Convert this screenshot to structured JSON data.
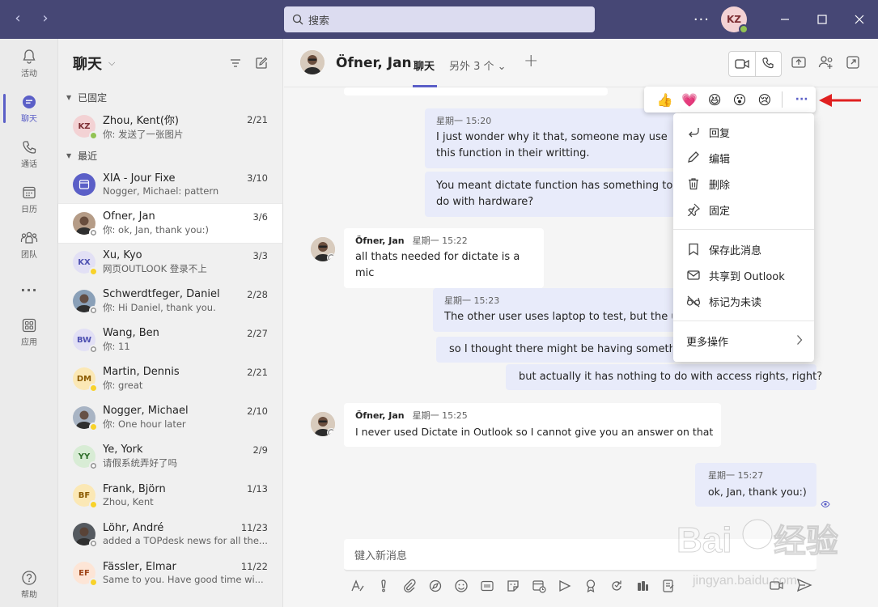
{
  "window": {
    "search_placeholder": "搜索",
    "more": "···",
    "user_initials": "KZ"
  },
  "rail": {
    "items": [
      {
        "label": "活动",
        "icon": "bell-icon"
      },
      {
        "label": "聊天",
        "icon": "chat-icon",
        "active": true
      },
      {
        "label": "通话",
        "icon": "phone-icon"
      },
      {
        "label": "日历",
        "icon": "calendar-icon"
      },
      {
        "label": "团队",
        "icon": "teams-icon"
      },
      {
        "label": "···",
        "icon": "more-icon"
      },
      {
        "label": "应用",
        "icon": "apps-icon"
      },
      {
        "label": "帮助",
        "icon": "help-icon"
      }
    ]
  },
  "chatlist": {
    "title": "聊天",
    "pinned_label": "已固定",
    "recent_label": "最近",
    "pinned": [
      {
        "name": "Zhou, Kent(你)",
        "preview": "你: 发送了一张图片",
        "date": "2/21",
        "initials": "KZ",
        "bg": "#f3d2d4",
        "fg": "#7d2e33",
        "status": "green"
      }
    ],
    "recent": [
      {
        "name": "XIA - Jour Fixe",
        "preview": "Nogger, Michael: pattern",
        "date": "3/10",
        "initials": "",
        "bg": "#5b5fc7",
        "fg": "#fff",
        "status": "none"
      },
      {
        "name": "Öfner, Jan",
        "preview": "你: ok, Jan, thank you:)",
        "date": "3/6",
        "initials": "",
        "bg": "#b59c87",
        "fg": "#fff",
        "status": "grey",
        "selected": true
      },
      {
        "name": "Xu, Kyo",
        "preview": "网页OUTLOOK 登录不上",
        "date": "3/3",
        "initials": "KX",
        "bg": "#e2e0f5",
        "fg": "#4f52b2",
        "status": "yellow"
      },
      {
        "name": "Schwerdtfeger, Daniel",
        "preview": "你: Hi Daniel, thank you.",
        "date": "2/28",
        "initials": "",
        "bg": "#8aa0b8",
        "fg": "#fff",
        "status": "grey"
      },
      {
        "name": "Wang, Ben",
        "preview": "你: 11",
        "date": "2/27",
        "initials": "BW",
        "bg": "#e2e0f5",
        "fg": "#4f52b2",
        "status": "grey"
      },
      {
        "name": "Martin, Dennis",
        "preview": "你: great",
        "date": "2/21",
        "initials": "DM",
        "bg": "#fbe8b5",
        "fg": "#8a5a00",
        "status": "yellow"
      },
      {
        "name": "Nogger, Michael",
        "preview": "你: One hour later",
        "date": "2/10",
        "initials": "",
        "bg": "#a8b4c4",
        "fg": "#fff",
        "status": "yellow"
      },
      {
        "name": "Ye, York",
        "preview": "请假系统弄好了吗",
        "date": "2/9",
        "initials": "YY",
        "bg": "#d8ecd5",
        "fg": "#2f6e2a",
        "status": "grey"
      },
      {
        "name": "Frank, Björn",
        "preview": "Zhou, Kent",
        "date": "1/13",
        "initials": "BF",
        "bg": "#fbe8b5",
        "fg": "#8a5a00",
        "status": "yellow"
      },
      {
        "name": "Löhr, André",
        "preview": "added a TOPdesk news for all the...",
        "date": "11/23",
        "initials": "",
        "bg": "#555a60",
        "fg": "#fff",
        "status": "grey"
      },
      {
        "name": "Fässler, Elmar",
        "preview": "Same to you. Have good time wi...",
        "date": "11/22",
        "initials": "EF",
        "bg": "#fde5d6",
        "fg": "#a0461a",
        "status": "yellow"
      }
    ]
  },
  "header": {
    "name": "Öfner, Jan",
    "tab": "聊天",
    "more_tabs": "另外 3 个 ⌄",
    "add": "+"
  },
  "messages": [
    {
      "id": "m1",
      "side": "mine",
      "time": "星期一 15:20",
      "text": "I just wonder why it that, someone may use this function in their writting."
    },
    {
      "id": "m2",
      "side": "mine",
      "time": "",
      "text": "You meant dictate function has something to do with hardware?"
    },
    {
      "id": "m3",
      "side": "theirs",
      "sender": "Öfner, Jan",
      "time": "星期一 15:22",
      "text": "all thats needed for dictate is a mic"
    },
    {
      "id": "m4",
      "side": "mine",
      "time": "星期一 15:23",
      "text": "The other user uses laptop to test, but the user uses desktop."
    },
    {
      "id": "m5",
      "side": "mine",
      "time": "",
      "text": "so I thought there might be having something wrong"
    },
    {
      "id": "m6",
      "side": "mine",
      "time": "",
      "text": "but actually it has nothing to do with access rights, right?"
    },
    {
      "id": "m7",
      "side": "theirs",
      "sender": "Öfner, Jan",
      "time": "星期一 15:25",
      "text": "I never used Dictate in Outlook so I cannot give you an answer on that"
    },
    {
      "id": "m8",
      "side": "mine",
      "time": "星期一 15:27",
      "text": "ok, Jan, thank you:)"
    }
  ],
  "reactions": {
    "emojis": [
      "👍",
      "💗",
      "😆",
      "😮",
      "😢"
    ],
    "more": "···"
  },
  "context_menu": {
    "reply": "回复",
    "edit": "编辑",
    "delete": "删除",
    "pin": "固定",
    "save": "保存此消息",
    "share_outlook": "共享到 Outlook",
    "mark_unread": "标记为未读",
    "more_actions": "更多操作"
  },
  "compose": {
    "placeholder": "键入新消息"
  },
  "colors": {
    "titlebar": "#464775",
    "accent": "#5b5fc7",
    "mine_bubble": "#e8ebfa",
    "arrow": "#e02020"
  }
}
